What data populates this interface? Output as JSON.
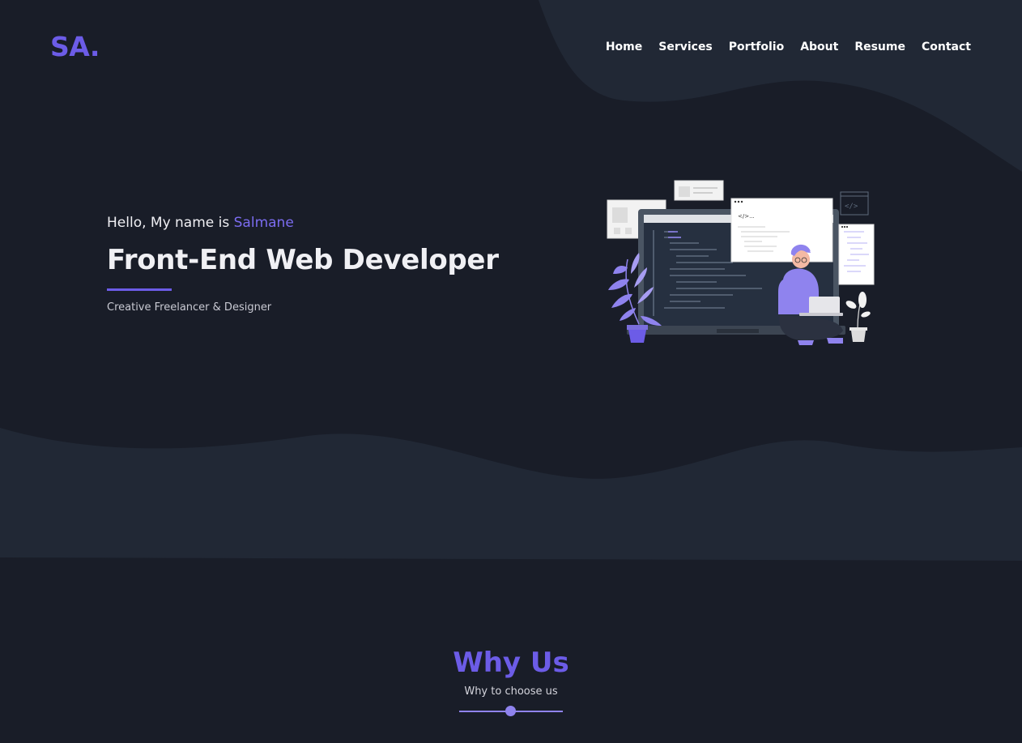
{
  "brand": {
    "logo": "SA."
  },
  "nav": {
    "items": [
      {
        "label": "Home"
      },
      {
        "label": "Services"
      },
      {
        "label": "Portfolio"
      },
      {
        "label": "About"
      },
      {
        "label": "Resume"
      },
      {
        "label": "Contact"
      }
    ]
  },
  "hero": {
    "greeting_prefix": "Hello, My name is ",
    "name": "Salmane",
    "headline": "Front-End Web Developer",
    "tagline": "Creative Freelancer & Designer",
    "illustration_code_label": "</>...",
    "illustration_icon_label": "</>"
  },
  "why_us": {
    "title": "Why Us",
    "subtitle": "Why to choose us"
  },
  "colors": {
    "background": "#191d28",
    "wave": "#212835",
    "accent": "#6c5ce7",
    "text": "#f0f0f4"
  }
}
